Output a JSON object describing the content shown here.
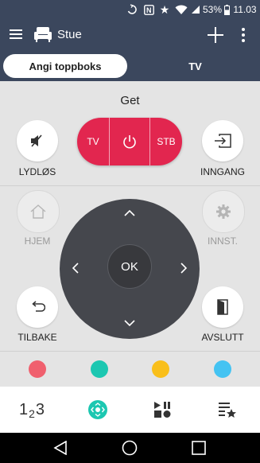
{
  "status_bar": {
    "battery": "53%",
    "time": "11.03"
  },
  "app_bar": {
    "title": "Stue"
  },
  "tabs": [
    {
      "label": "Angi toppboks",
      "active": true
    },
    {
      "label": "TV",
      "active": false
    }
  ],
  "remote": {
    "section_title": "Get",
    "mute_label": "LYDLØS",
    "input_label": "INNGANG",
    "home_label": "HJEM",
    "settings_label": "INNST.",
    "back_label": "TILBAKE",
    "exit_label": "AVSLUTT",
    "power_group": {
      "tv_label": "TV",
      "stb_label": "STB"
    },
    "ok_label": "OK",
    "color_buttons": [
      "#f0606e",
      "#1cc7b1",
      "#f9bf1a",
      "#44c3f2"
    ]
  },
  "bottom_nav": [
    {
      "name": "numpad",
      "glyph": "123"
    },
    {
      "name": "remote",
      "glyph": "remote-icon"
    },
    {
      "name": "media",
      "glyph": "media-controls-icon"
    },
    {
      "name": "favorites",
      "glyph": "favorites-icon"
    }
  ],
  "colors": {
    "bar": "#3b475d",
    "accent": "#e2264f",
    "teal": "#1cc7b1"
  }
}
